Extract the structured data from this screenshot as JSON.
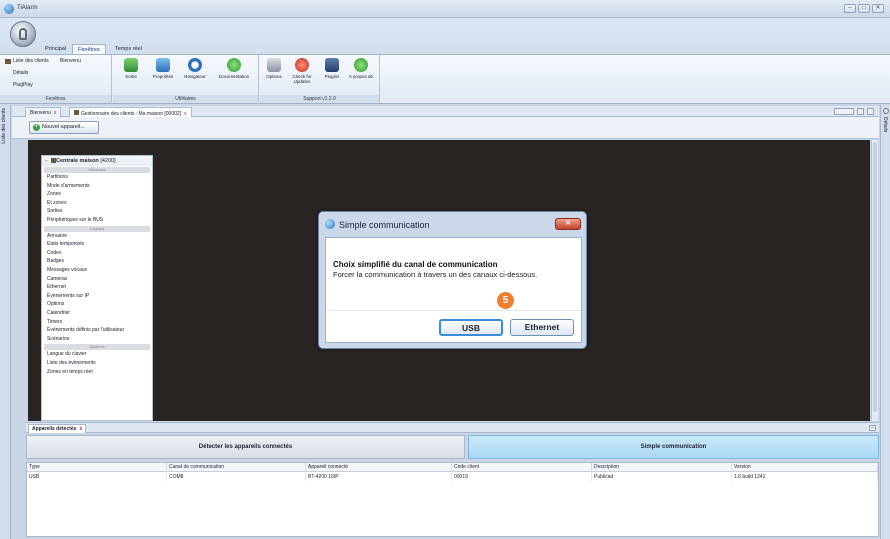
{
  "window": {
    "title": "TiAlarm",
    "minimize": "–",
    "maximize": "▭",
    "close": "✕"
  },
  "ribbon": {
    "tabs": [
      "Principal",
      "Fenêtres",
      "Temps réel"
    ],
    "active_tab": "Fenêtres",
    "groups": {
      "fenetres": {
        "label": "Fenêtres",
        "items": [
          "Liste des clients",
          "Bienvenu",
          "Détails",
          "PlugPlay"
        ]
      },
      "utilitaires": {
        "label": "Utilitaires",
        "buttons": [
          "Sortie",
          "Propriétés",
          "Navigateur",
          "Documentation"
        ]
      },
      "support": {
        "label": "Support v1.2.0",
        "buttons": [
          "Options",
          "Check for Updates",
          "Plugins",
          "A propos de"
        ]
      }
    }
  },
  "sidebars": {
    "left_label": "Liste des clients",
    "right_label": "Détails"
  },
  "doc_tabs": [
    {
      "label": "Bienvenu"
    },
    {
      "label": "Gestionnaire des clients : Ma maison [00002]"
    }
  ],
  "tab_close": "x",
  "toolbar": {
    "new_device": "Nouvel appareil..."
  },
  "tree": {
    "title": "Centrale maison",
    "title_suffix": "[4200]",
    "collapse": "–",
    "sections": [
      {
        "label": "Hardware",
        "items": [
          "Partitions",
          "Mode d'armements",
          "Zones",
          "Et zones",
          "Sorties",
          "Périphériques sur le BUS"
        ]
      },
      {
        "label": "Logique",
        "items": [
          "Annuaire",
          "Etats temporisés",
          "Codes",
          "Badges",
          "Messages vocaux",
          "Cameras",
          "Ethernet",
          "Évènements sur IP",
          "Options",
          "Calendrier",
          "Timers",
          "Événements définis par l'utilisateur",
          "Scénarios"
        ]
      },
      {
        "label": "Système",
        "items": [
          "Langue du clavier",
          "Liste des évènements",
          "Zones en temps réel"
        ]
      }
    ]
  },
  "dialog": {
    "title": "Simple communication",
    "close": "✕",
    "heading": "Choix simplifié du canal de communication",
    "text": "Forcer la communication à travers un des canaux ci-dessous.",
    "step": "5",
    "usb_label": "USB",
    "ethernet_label": "Ethernet"
  },
  "bottom": {
    "tab_label": "Appareils détectés",
    "minimize": "–",
    "detect_label": "Détecter les appareils connectés",
    "simple_label": "Simple communication",
    "columns": [
      "Type",
      "Canal de communication",
      "Appareil connecté",
      "Code client",
      "Description",
      "Version"
    ],
    "rows": [
      [
        "USB",
        "COM8",
        "BT-4200 16IP",
        "00019",
        "Publicad",
        "1.6 build 1241"
      ]
    ]
  }
}
